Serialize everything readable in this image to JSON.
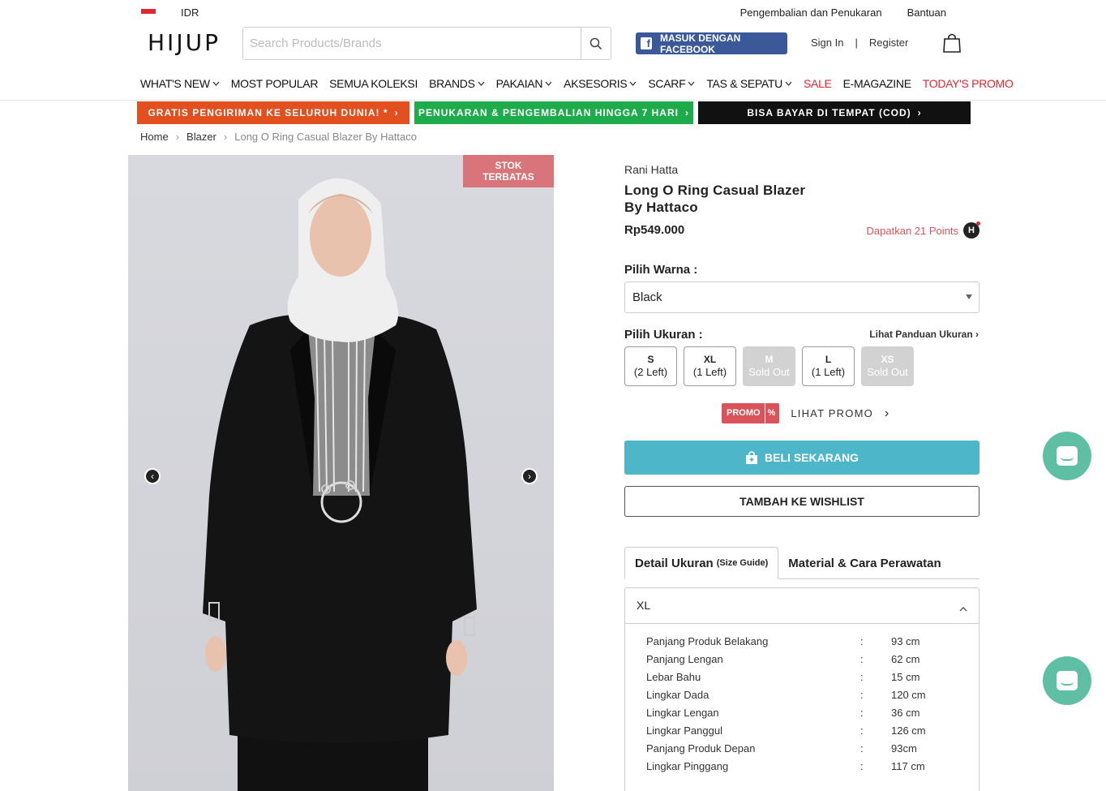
{
  "topbar": {
    "currency": "IDR",
    "returns_link": "Pengembalian dan Penukaran",
    "help_link": "Bantuan"
  },
  "header": {
    "logo": "HIJUP",
    "search_placeholder": "Search Products/Brands",
    "facebook_label": "MASUK DENGAN FACEBOOK",
    "signin": "Sign In",
    "separator": "|",
    "register": "Register"
  },
  "nav": {
    "items": [
      {
        "label": "WHAT'S NEW",
        "dropdown": true,
        "color": "#111"
      },
      {
        "label": "MOST POPULAR",
        "dropdown": false,
        "color": "#111"
      },
      {
        "label": "SEMUA KOLEKSI",
        "dropdown": false,
        "color": "#111"
      },
      {
        "label": "BRANDS",
        "dropdown": true,
        "color": "#111"
      },
      {
        "label": "PAKAIAN",
        "dropdown": true,
        "color": "#111"
      },
      {
        "label": "AKSESORIS",
        "dropdown": true,
        "color": "#111"
      },
      {
        "label": "SCARF",
        "dropdown": true,
        "color": "#111"
      },
      {
        "label": "TAS & SEPATU",
        "dropdown": true,
        "color": "#111"
      },
      {
        "label": "SALE",
        "dropdown": false,
        "color": "#e3262f"
      },
      {
        "label": "E-MAGAZINE",
        "dropdown": false,
        "color": "#111"
      },
      {
        "label": "TODAY'S PROMO",
        "dropdown": false,
        "color": "#e3262f"
      }
    ]
  },
  "banners": [
    {
      "label": "GRATIS PENGIRIMAN KE SELURUH DUNIA! *",
      "color": "#e3501f"
    },
    {
      "label": "PENUKARAN & PENGEMBALIAN HINGGA 7 HARI",
      "color": "#1eab4c"
    },
    {
      "label": "BISA BAYAR DI TEMPAT (COD)",
      "color": "#111111"
    }
  ],
  "breadcrumb": {
    "home": "Home",
    "category": "Blazer",
    "current": "Long O Ring Casual Blazer By Hattaco"
  },
  "gallery": {
    "badge": "STOK TERBATAS",
    "prev_icon": "chevron-left-icon",
    "next_icon": "chevron-right-icon"
  },
  "product": {
    "brand": "Rani Hatta",
    "title_line1": "Long O Ring Casual Blazer",
    "title_line2": "By Hattaco",
    "price": "Rp549.000",
    "points_text": "Dapatkan 21 Points",
    "points_icon_letter": "H",
    "color_label": "Pilih Warna :",
    "color_value": "Black",
    "size_label": "Pilih Ukuran :",
    "size_guide": "Lihat Panduan Ukuran",
    "sizes": [
      {
        "name": "S",
        "stock": "(2 Left)",
        "sold_out": false
      },
      {
        "name": "XL",
        "stock": "(1 Left)",
        "sold_out": false
      },
      {
        "name": "M",
        "stock": "Sold Out",
        "sold_out": true
      },
      {
        "name": "L",
        "stock": "(1 Left)",
        "sold_out": false
      },
      {
        "name": "XS",
        "stock": "Sold Out",
        "sold_out": true
      }
    ],
    "promo_badge": "PROMO",
    "promo_percent": "%",
    "promo_link": "LIHAT PROMO",
    "buy_label": "BELI SEKARANG",
    "wishlist_label": "TAMBAH KE WISHLIST"
  },
  "details": {
    "tab1": "Detail Ukuran",
    "tab1_sub": "(Size Guide)",
    "tab2": "Material & Cara Perawatan",
    "selected_size": "XL",
    "rows": [
      {
        "k": "Panjang Produk Belakang",
        "c": ":",
        "v": "93 cm"
      },
      {
        "k": "Panjang Lengan",
        "c": ":",
        "v": "62 cm"
      },
      {
        "k": "Lebar Bahu",
        "c": ":",
        "v": "15 cm"
      },
      {
        "k": "Lingkar Dada",
        "c": ":",
        "v": "120 cm"
      },
      {
        "k": "Lingkar Lengan",
        "c": ":",
        "v": "36 cm"
      },
      {
        "k": "Lingkar Panggul",
        "c": ":",
        "v": "126 cm"
      },
      {
        "k": "Panjang Produk Depan",
        "c": ":",
        "v": "93cm"
      },
      {
        "k": "Lingkar Pinggang",
        "c": ":",
        "v": "117 cm"
      }
    ]
  }
}
